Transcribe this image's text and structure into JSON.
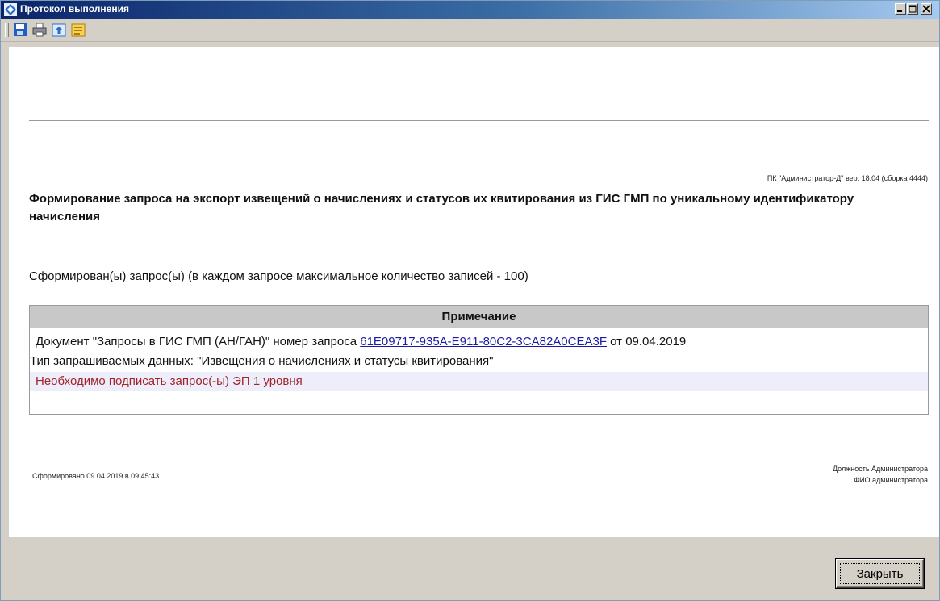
{
  "window": {
    "title": "Протокол выполнения"
  },
  "toolbar": {
    "buttons": [
      {
        "icon": "save-icon"
      },
      {
        "icon": "print-icon"
      },
      {
        "icon": "export-icon"
      },
      {
        "icon": "settings-icon"
      }
    ]
  },
  "report": {
    "version": "ПК \"Администратор-Д\" вер. 18.04 (сборка 4444)",
    "heading": "Формирование запроса на экспорт извещений о начислениях и статусов их квитирования из ГИС ГМП по уникальному идентификатору начисления",
    "info": "Сформирован(ы) запрос(ы) (в каждом запросе максимальное количество записей - 100)",
    "table": {
      "header": "Примечание",
      "row1_prefix": "Документ \"Запросы в ГИС ГМП (АН/ГАН)\" номер запроса ",
      "row1_link": "61E09717-935A-E911-80C2-3CA82A0CEA3F",
      "row1_suffix": " от 09.04.2019",
      "row2": "Тип запрашиваемых данных: \"Извещения о начислениях и статусы квитирования\"",
      "row3": "Необходимо подписать запрос(-ы) ЭП 1 уровня"
    },
    "footer": {
      "generated": "Сформировано 09.04.2019 в 09:45:43",
      "position": "Должность Администратора",
      "name": "ФИО администратора"
    }
  },
  "actions": {
    "close_label": "Закрыть"
  },
  "colors": {
    "title_bar": "#0a246a",
    "warning_text": "#a0242c",
    "link": "#1a1aa6"
  }
}
